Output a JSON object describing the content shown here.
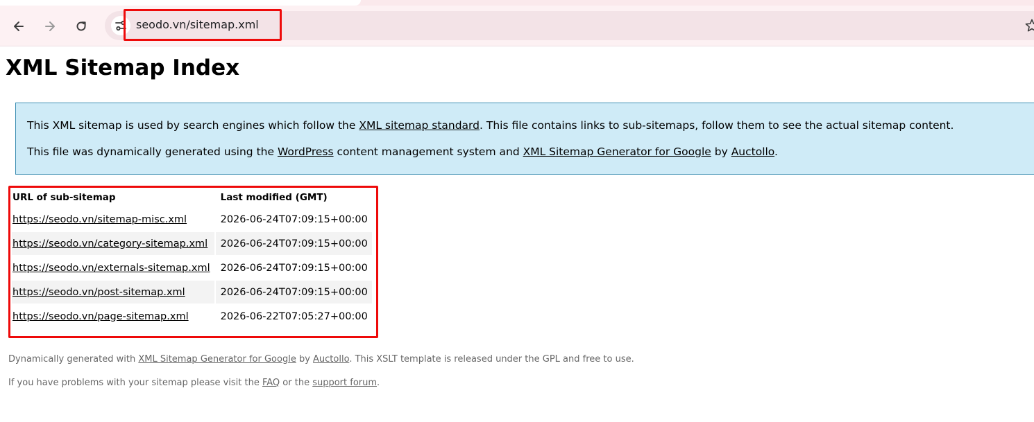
{
  "browser": {
    "url": "seodo.vn/sitemap.xml",
    "back_icon": "arrow-left-icon",
    "forward_icon": "arrow-right-icon",
    "reload_icon": "reload-icon",
    "site_info_icon": "tune-icon",
    "bookmark_icon": "star-icon",
    "highlight_color": "#ee0a0a"
  },
  "page": {
    "title": "XML Sitemap Index"
  },
  "intro": {
    "line1": {
      "before": "This XML sitemap is used by search engines which follow the ",
      "link": "XML sitemap standard",
      "after": ". This file contains links to sub-sitemaps, follow them to see the actual sitemap content."
    },
    "line2": {
      "before": "This file was dynamically generated using the ",
      "link1": "WordPress",
      "middle": " content management system and ",
      "link2": "XML Sitemap Generator for Google",
      "by": " by ",
      "link3": "Auctollo",
      "end": "."
    },
    "bg_color": "#cfebf7",
    "border_color": "#3d8fb2"
  },
  "table": {
    "headers": [
      "URL of sub-sitemap",
      "Last modified (GMT)"
    ],
    "rows": [
      {
        "url": "https://seodo.vn/sitemap-misc.xml",
        "modified": "2026-06-24T07:09:15+00:00"
      },
      {
        "url": "https://seodo.vn/category-sitemap.xml",
        "modified": "2026-06-24T07:09:15+00:00"
      },
      {
        "url": "https://seodo.vn/externals-sitemap.xml",
        "modified": "2026-06-24T07:09:15+00:00"
      },
      {
        "url": "https://seodo.vn/post-sitemap.xml",
        "modified": "2026-06-24T07:09:15+00:00"
      },
      {
        "url": "https://seodo.vn/page-sitemap.xml",
        "modified": "2026-06-22T07:05:27+00:00"
      }
    ]
  },
  "footer": {
    "line1": {
      "before": "Dynamically generated with ",
      "link1": "XML Sitemap Generator for Google",
      "by": " by ",
      "link2": "Auctollo",
      "after": ". This XSLT template is released under the GPL and free to use."
    },
    "line2": {
      "before": "If you have problems with your sitemap please visit the ",
      "link1": "FAQ",
      "middle": " or the ",
      "link2": "support forum",
      "end": "."
    }
  }
}
